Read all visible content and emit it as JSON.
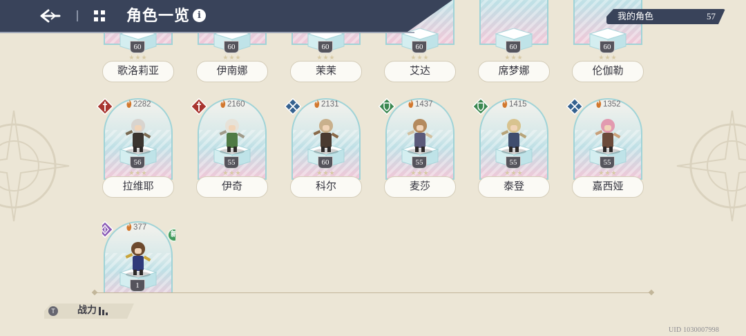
{
  "header": {
    "title": "角色一览",
    "info_icon_text": "i",
    "back_icon": "back-arrow-icon",
    "grid_icon": "grid-icon"
  },
  "counter": {
    "label": "我的角色",
    "value": "57"
  },
  "colors": {
    "header_bg": "#39435a",
    "background": "#ece6d6",
    "card_border": "#9fd3d7",
    "class_red": "#a8352f",
    "class_blue": "#35618f",
    "class_green": "#3b8850",
    "class_purple": "#8a5ab5"
  },
  "top_row": [
    {
      "name": "歌洛莉亚",
      "level": "60",
      "stars": "★★★"
    },
    {
      "name": "伊南娜",
      "level": "60",
      "stars": "★★★"
    },
    {
      "name": "茉茉",
      "level": "60",
      "stars": "★★★"
    },
    {
      "name": "艾达",
      "level": "60",
      "stars": "★★★"
    },
    {
      "name": "席梦娜",
      "level": "60",
      "stars": "★★★"
    },
    {
      "name": "伦伽勒",
      "level": "60",
      "stars": "★★★"
    }
  ],
  "middle_row": [
    {
      "name": "拉维耶",
      "level": "56",
      "stars": "★★★",
      "power": "2282",
      "class_icon": "sword-class-icon"
    },
    {
      "name": "伊奇",
      "level": "55",
      "stars": "★★★",
      "power": "2160",
      "class_icon": "sword-class-icon"
    },
    {
      "name": "科尔",
      "level": "60",
      "stars": "★★★",
      "power": "2131",
      "class_icon": "crossed-blades-class-icon"
    },
    {
      "name": "麦莎",
      "level": "55",
      "stars": "★★★",
      "power": "1437",
      "class_icon": "shield-class-icon"
    },
    {
      "name": "泰登",
      "level": "55",
      "stars": "★★★",
      "power": "1415",
      "class_icon": "shield-class-icon"
    },
    {
      "name": "嘉西娅",
      "level": "55",
      "stars": "★★★",
      "power": "1352",
      "class_icon": "crossed-blades-class-icon"
    }
  ],
  "bottom_row": [
    {
      "level": "1",
      "power": "377",
      "class_icon": "magic-class-icon",
      "new_badge": "新"
    }
  ],
  "sort": {
    "key_hint": "T",
    "label": "战力"
  },
  "uid": "UID 1030007998"
}
